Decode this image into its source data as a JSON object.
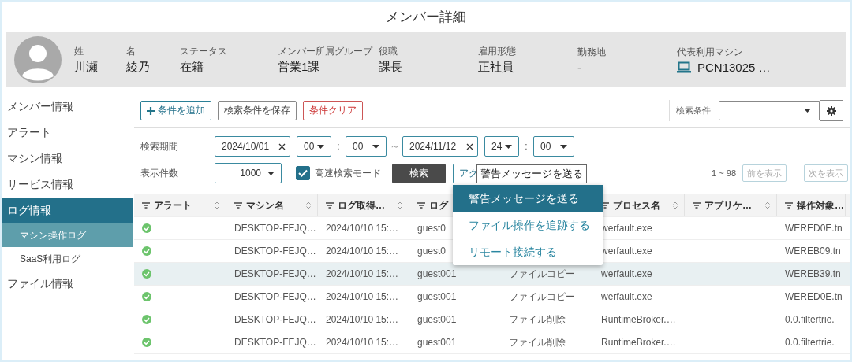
{
  "window": {
    "title": "メンバー詳細"
  },
  "profile": {
    "fields": [
      {
        "label": "姓",
        "value": "川瀬",
        "kind": "text"
      },
      {
        "label": "名",
        "value": "綾乃",
        "kind": "text"
      },
      {
        "label": "ステータス",
        "value": "在籍",
        "kind": "text"
      },
      {
        "label": "メンバー所属グループ",
        "value": "営業1課",
        "kind": "text"
      },
      {
        "label": "役職",
        "value": "課長",
        "kind": "text"
      },
      {
        "label": "雇用形態",
        "value": "正社員",
        "kind": "text"
      },
      {
        "label": "勤務地",
        "value": "-",
        "kind": "text"
      },
      {
        "label": "代表利用マシン",
        "value": "PCN13025 …",
        "kind": "machine"
      }
    ]
  },
  "sidebar": {
    "items": [
      {
        "label": "メンバー情報",
        "selected": false
      },
      {
        "label": "アラート",
        "selected": false
      },
      {
        "label": "マシン情報",
        "selected": false
      },
      {
        "label": "サービス情報",
        "selected": false
      },
      {
        "label": "ログ情報",
        "selected": true,
        "children": [
          {
            "label": "マシン操作ログ",
            "selected": true
          },
          {
            "label": "SaaS利用ログ",
            "selected": false
          }
        ]
      },
      {
        "label": "ファイル情報",
        "selected": false
      }
    ]
  },
  "toolbar": {
    "buttons": [
      {
        "label": "条件を追加",
        "kind": "add"
      },
      {
        "label": "検索条件を保存",
        "kind": "plain"
      },
      {
        "label": "条件クリア",
        "kind": "danger"
      }
    ],
    "saved_search": {
      "label": "検索条件"
    }
  },
  "filters": {
    "period": {
      "label": "検索期間",
      "from": {
        "date": "2024/10/01",
        "hour": "00",
        "colon": ":",
        "minute": "00"
      },
      "separator": "～",
      "to": {
        "date": "2024/11/12",
        "hour": "24",
        "colon": ":",
        "minute": "00"
      }
    },
    "count": {
      "label": "表示件数",
      "value": "1000"
    },
    "fast_mode": {
      "label": "高速検索モード",
      "checked": true
    },
    "search_button": "検索",
    "action_button": "アク",
    "range": "1 ~ 98",
    "prev": {
      "label": "前を表示",
      "disabled": true
    },
    "next": {
      "label": "次を表示",
      "disabled": true
    }
  },
  "tooltip": "警告メッセージを送る",
  "action_menu": {
    "items": [
      {
        "label": "警告メッセージを送る",
        "selected": true
      },
      {
        "label": "ファイル操作を追跡する",
        "selected": false
      },
      {
        "label": "リモート接続する",
        "selected": false
      }
    ]
  },
  "table": {
    "columns": [
      {
        "label": "アラート",
        "sort_icon": true
      },
      {
        "label": "マシン名",
        "sort_icon": true
      },
      {
        "label": "ログ取得…",
        "sort_icon": true
      },
      {
        "label": "ログ",
        "sort_icon": false
      },
      {},
      {
        "label": "プロセス名",
        "sort_icon": true
      },
      {
        "label": "アプリケ…",
        "sort_icon": true
      },
      {
        "label": "操作対象…",
        "sort_icon": false
      }
    ],
    "rows": [
      {
        "alert_ok": true,
        "selected": false,
        "cells": [
          "",
          "DESKTOP-FEJQ…",
          "2024/10/10 15:…",
          "guest0",
          "",
          "werfault.exe",
          "",
          "WERED0E.tn"
        ]
      },
      {
        "alert_ok": true,
        "selected": false,
        "cells": [
          "",
          "DESKTOP-FEJQ…",
          "2024/10/10 15:…",
          "guest0",
          "",
          "werfault.exe",
          "",
          "WEREB09.tn"
        ]
      },
      {
        "alert_ok": true,
        "selected": true,
        "cells": [
          "",
          "DESKTOP-FEJQ…",
          "2024/10/10 15:…",
          "guest001",
          "ファイルコピー",
          "werfault.exe",
          "",
          "WEREB39.tn"
        ]
      },
      {
        "alert_ok": true,
        "selected": false,
        "cells": [
          "",
          "DESKTOP-FEJQ…",
          "2024/10/10 15:…",
          "guest001",
          "ファイルコピー",
          "werfault.exe",
          "",
          "WERED0E.tn"
        ]
      },
      {
        "alert_ok": true,
        "selected": false,
        "cells": [
          "",
          "DESKTOP-FEJQ…",
          "2024/10/10 15:…",
          "guest001",
          "ファイル削除",
          "RuntimeBroker.…",
          "",
          "0.0.filtertrie."
        ]
      },
      {
        "alert_ok": true,
        "selected": false,
        "cells": [
          "",
          "DESKTOP-FEJQ…",
          "2024/10/10 15:…",
          "guest001",
          "ファイル削除",
          "RuntimeBroker.…",
          "",
          "0.0.filtertrie."
        ]
      }
    ]
  }
}
